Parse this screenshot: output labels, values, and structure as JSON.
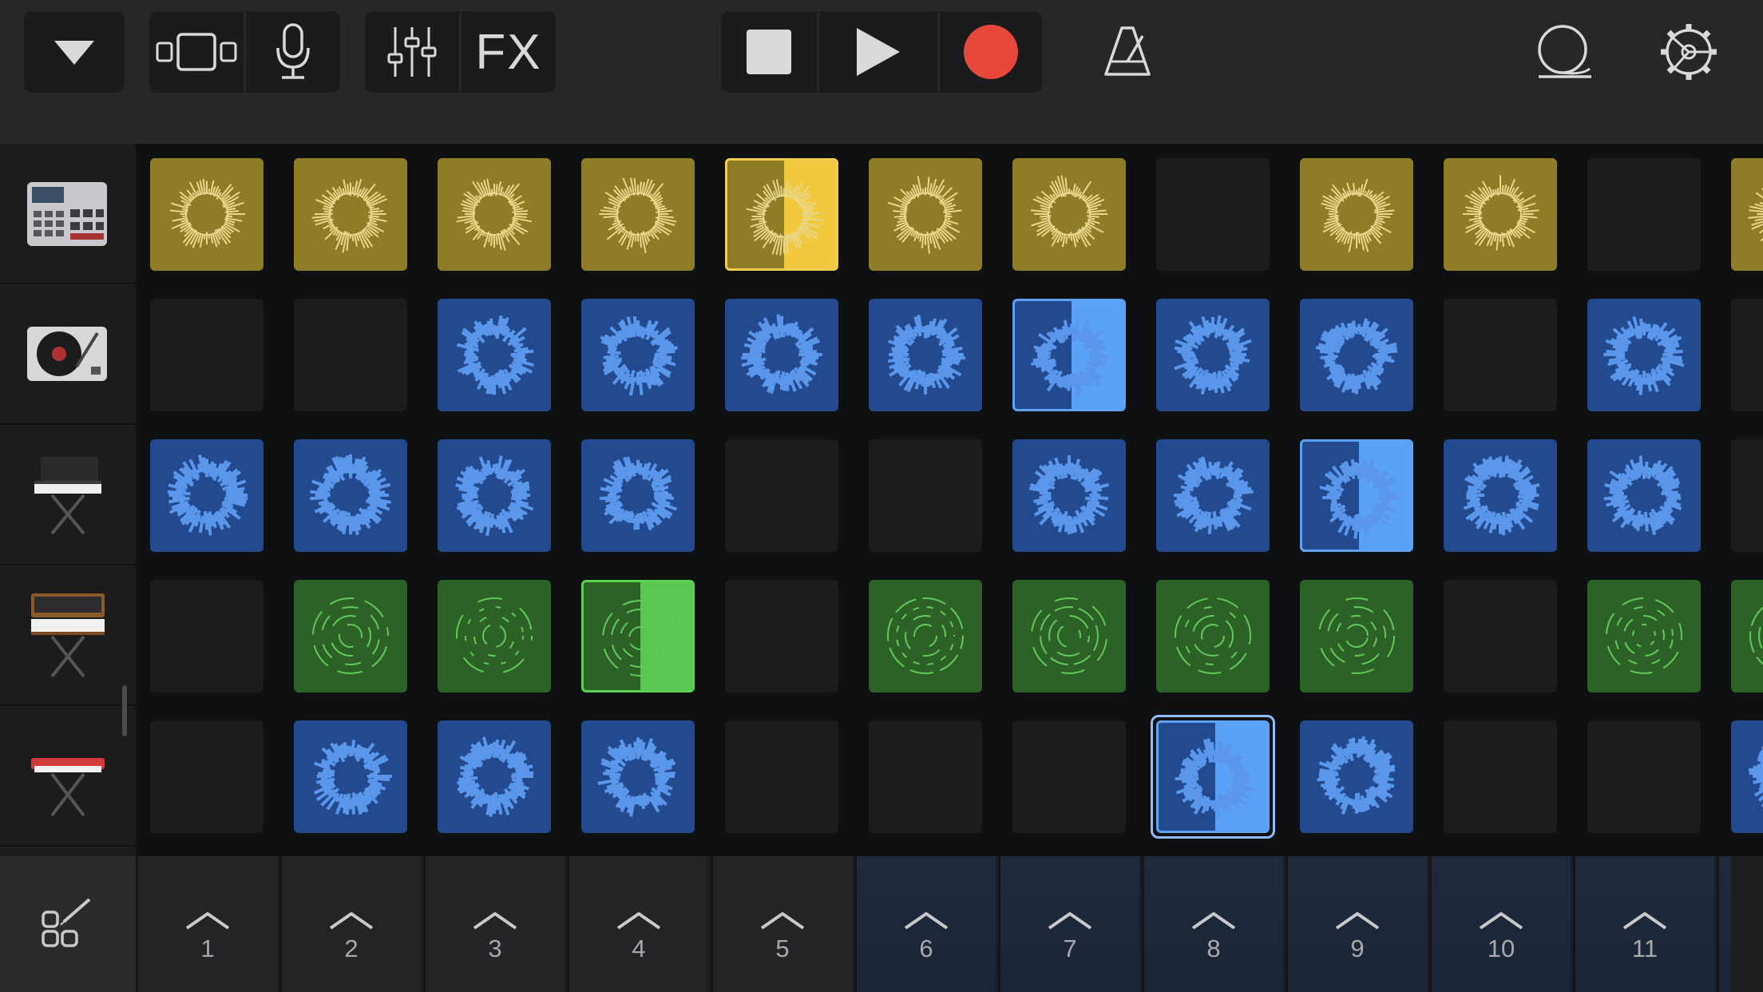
{
  "toolbar": {
    "buttons": [
      {
        "name": "browser-menu-button",
        "icon": "triangle-down-icon"
      },
      {
        "name": "view-toggle-button",
        "icon": "view-toggle-icon"
      },
      {
        "name": "microphone-button",
        "icon": "microphone-icon"
      },
      {
        "name": "mixer-button",
        "icon": "mixer-sliders-icon"
      },
      {
        "name": "fx-button",
        "label": "FX"
      },
      {
        "name": "stop-button",
        "icon": "stop-icon"
      },
      {
        "name": "play-button",
        "icon": "play-icon"
      },
      {
        "name": "record-button",
        "icon": "record-icon"
      },
      {
        "name": "metronome-button",
        "icon": "metronome-icon"
      },
      {
        "name": "loop-browser-button",
        "icon": "loop-icon"
      },
      {
        "name": "settings-button",
        "icon": "settings-gear-icon"
      }
    ],
    "fx_label": "FX",
    "colors": {
      "bar": "#262729",
      "group": "#1a1b1c",
      "record": "#e8473b"
    }
  },
  "tracks": [
    {
      "instrument": "drum-machine",
      "icon": "drum-machine-icon"
    },
    {
      "instrument": "turntable",
      "icon": "turntable-icon"
    },
    {
      "instrument": "synth-keyboard",
      "icon": "synth-keyboard-icon"
    },
    {
      "instrument": "analog-synth",
      "icon": "analog-synth-icon"
    },
    {
      "instrument": "red-keyboard",
      "icon": "red-keyboard-icon"
    }
  ],
  "grid": {
    "rows": [
      [
        "y",
        "y",
        "y",
        "y",
        "y*",
        "y",
        "y",
        "e",
        "y",
        "y",
        "e",
        "y"
      ],
      [
        "e",
        "e",
        "b",
        "b",
        "b",
        "b",
        "b*",
        "b",
        "b",
        "e",
        "b",
        "e"
      ],
      [
        "b",
        "b",
        "b",
        "b",
        "e",
        "e",
        "b",
        "b",
        "b*",
        "b",
        "b",
        "e"
      ],
      [
        "e",
        "g",
        "g",
        "g*",
        "e",
        "g",
        "g",
        "g",
        "g",
        "e",
        "g",
        "g"
      ],
      [
        "e",
        "b",
        "b",
        "b",
        "e",
        "e",
        "e",
        "b*",
        "b",
        "e",
        "e",
        "b"
      ]
    ],
    "legend": {
      "y": "yellow cell",
      "b": "blue cell",
      "g": "green cell",
      "e": "empty",
      "*": "playing"
    },
    "colors": {
      "yellow": "#8f7c26",
      "blue": "#234a8f",
      "green": "#2d6227",
      "empty": "#1b1c1d"
    }
  },
  "scene_triggers": [
    "1",
    "2",
    "3",
    "4",
    "5",
    "6",
    "7",
    "8",
    "9",
    "10",
    "11"
  ],
  "active_scenes": [
    "6",
    "7",
    "8",
    "9",
    "10",
    "11"
  ],
  "edit_button": {
    "icon": "edit-cells-icon"
  }
}
